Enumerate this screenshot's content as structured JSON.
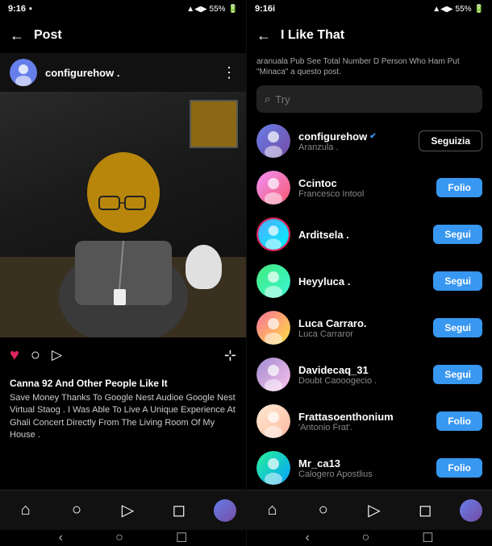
{
  "left": {
    "statusBar": {
      "time": "9:16",
      "batteryIcon": "▪",
      "batteryPercent": "55%"
    },
    "topBar": {
      "backArrow": "←",
      "title": "Post"
    },
    "postHeader": {
      "username": "configurehow .",
      "moreDots": "⋮"
    },
    "actionBar": {
      "heartIcon": "♥",
      "commentIcon": "○",
      "shareIcon": "▷",
      "bookmarkIcon": "⊹"
    },
    "likesCount": "Canna 92 And Other People Like It",
    "caption": "Save Money Thanks To Google Nest Audioe Google Nest Virtual Staog . I Was Able To Live A Unique Experience At Ghali Concert Directly From The Living Room Of My House .",
    "bottomNav": {
      "items": [
        "⌂",
        "○",
        "▷",
        "◻",
        "●"
      ]
    },
    "gestureBar": {
      "back": "‹",
      "home": "○",
      "recents": "☐"
    }
  },
  "right": {
    "statusBar": {
      "time": "9:16i",
      "batteryPercent": "55%"
    },
    "topBar": {
      "backArrow": "←",
      "title": "I Like That"
    },
    "likesInfo": "aranuala Pub See Total Number D Person Who Ham Put \"Minaca\" a questo post.",
    "search": {
      "placeholder": "Try",
      "icon": "⌕"
    },
    "users": [
      {
        "username": "configurehow",
        "verified": true,
        "realname": "Aranzula .",
        "buttonLabel": "Seguizia",
        "buttonType": "outlined",
        "avatarClass": "av1"
      },
      {
        "username": "Ccintoc",
        "verified": false,
        "realname": "Francesco Intool",
        "buttonLabel": "Folio",
        "buttonType": "following",
        "avatarClass": "av2"
      },
      {
        "username": "Arditsela .",
        "verified": false,
        "realname": "",
        "buttonLabel": "Segui",
        "buttonType": "follow",
        "hasRing": true,
        "avatarClass": "av3"
      },
      {
        "username": "Heyyluca .",
        "verified": false,
        "realname": "",
        "buttonLabel": "Segui",
        "buttonType": "follow",
        "avatarClass": "av4"
      },
      {
        "username": "Luca Carraro.",
        "verified": false,
        "realname": "Luca Carraror",
        "buttonLabel": "Segui",
        "buttonType": "follow",
        "avatarClass": "av5"
      },
      {
        "username": "Davidecaq_31",
        "verified": false,
        "realname": "Doubt Caooogecio .",
        "buttonLabel": "Segui",
        "buttonType": "follow",
        "avatarClass": "av6"
      },
      {
        "username": "Frattasoenthonium",
        "verified": false,
        "realname": "'Antonio Frat'.",
        "buttonLabel": "Folio",
        "buttonType": "following",
        "avatarClass": "av7"
      },
      {
        "username": "Mr_ca13",
        "verified": false,
        "realname": "Calogero Apostlius",
        "buttonLabel": "Folio",
        "buttonType": "following",
        "avatarClass": "av8"
      }
    ],
    "bottomNav": {
      "items": [
        "⌂",
        "○",
        "▷",
        "◻",
        "●"
      ]
    },
    "gestureBar": {
      "back": "‹",
      "home": "○",
      "recents": "☐"
    }
  }
}
